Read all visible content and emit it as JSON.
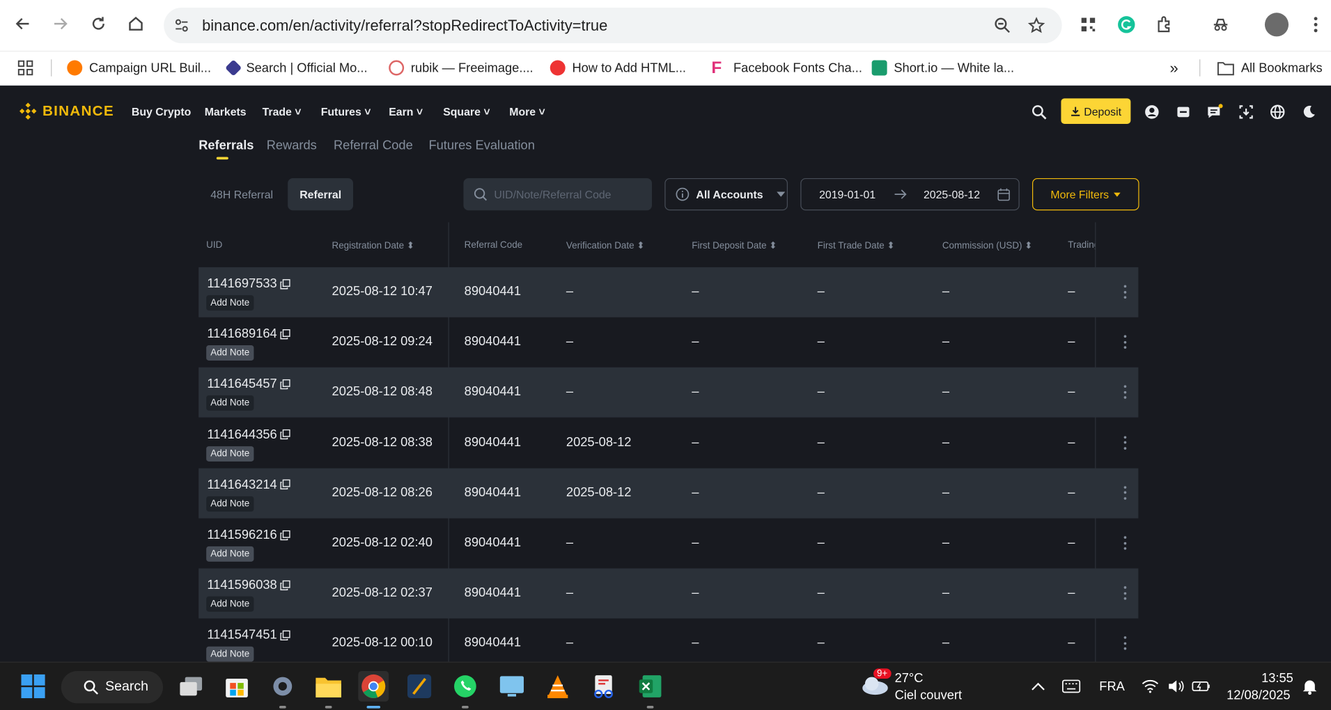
{
  "browser": {
    "url": "binance.com/en/activity/referral?stopRedirectToActivity=true",
    "bookmarks": [
      "Campaign URL Buil...",
      "Search | Official Mo...",
      "rubik — Freeimage....",
      "How to Add HTML...",
      "Facebook Fonts Cha...",
      "Short.io — White la..."
    ],
    "all_bookmarks": "All Bookmarks"
  },
  "header": {
    "brand": "BINANCE",
    "menu": [
      "Buy Crypto",
      "Markets",
      "Trade",
      "Futures",
      "Earn",
      "Square",
      "More"
    ],
    "deposit": "Deposit"
  },
  "tabs": [
    "Referrals",
    "Rewards",
    "Referral Code",
    "Futures Evaluation"
  ],
  "subtabs": [
    "48H Referral",
    "Referral"
  ],
  "filters": {
    "search_placeholder": "UID/Note/Referral Code",
    "accounts": "All Accounts",
    "date_from": "2019-01-01",
    "date_to": "2025-08-12",
    "more_filters": "More Filters"
  },
  "table": {
    "columns": [
      "UID",
      "Registration Date",
      "Referral Code",
      "Verification Date",
      "First Deposit Date",
      "First Trade Date",
      "Commission (USD)",
      "Trading"
    ],
    "add_note": "Add Note",
    "rows": [
      {
        "uid": "1141697533",
        "reg": "2025-08-12 10:47",
        "code": "89040441",
        "verif": "–",
        "dep": "–",
        "trade": "–",
        "comm": "–",
        "trading": "–"
      },
      {
        "uid": "1141689164",
        "reg": "2025-08-12 09:24",
        "code": "89040441",
        "verif": "–",
        "dep": "–",
        "trade": "–",
        "comm": "–",
        "trading": "–"
      },
      {
        "uid": "1141645457",
        "reg": "2025-08-12 08:48",
        "code": "89040441",
        "verif": "–",
        "dep": "–",
        "trade": "–",
        "comm": "–",
        "trading": "–"
      },
      {
        "uid": "1141644356",
        "reg": "2025-08-12 08:38",
        "code": "89040441",
        "verif": "2025-08-12",
        "dep": "–",
        "trade": "–",
        "comm": "–",
        "trading": "–"
      },
      {
        "uid": "1141643214",
        "reg": "2025-08-12 08:26",
        "code": "89040441",
        "verif": "2025-08-12",
        "dep": "–",
        "trade": "–",
        "comm": "–",
        "trading": "–"
      },
      {
        "uid": "1141596216",
        "reg": "2025-08-12 02:40",
        "code": "89040441",
        "verif": "–",
        "dep": "–",
        "trade": "–",
        "comm": "–",
        "trading": "–"
      },
      {
        "uid": "1141596038",
        "reg": "2025-08-12 02:37",
        "code": "89040441",
        "verif": "–",
        "dep": "–",
        "trade": "–",
        "comm": "–",
        "trading": "–"
      },
      {
        "uid": "1141547451",
        "reg": "2025-08-12 00:10",
        "code": "89040441",
        "verif": "–",
        "dep": "–",
        "trade": "–",
        "comm": "–",
        "trading": "–"
      }
    ]
  },
  "taskbar": {
    "search": "Search",
    "weather_badge": "9+",
    "weather_temp": "27°C",
    "weather_desc": "Ciel couvert",
    "lang": "FRA",
    "time": "13:55",
    "date": "12/08/2025"
  },
  "colors": {
    "accent": "#fcd535",
    "bg": "#181a20",
    "row_alt": "#2b3139"
  }
}
